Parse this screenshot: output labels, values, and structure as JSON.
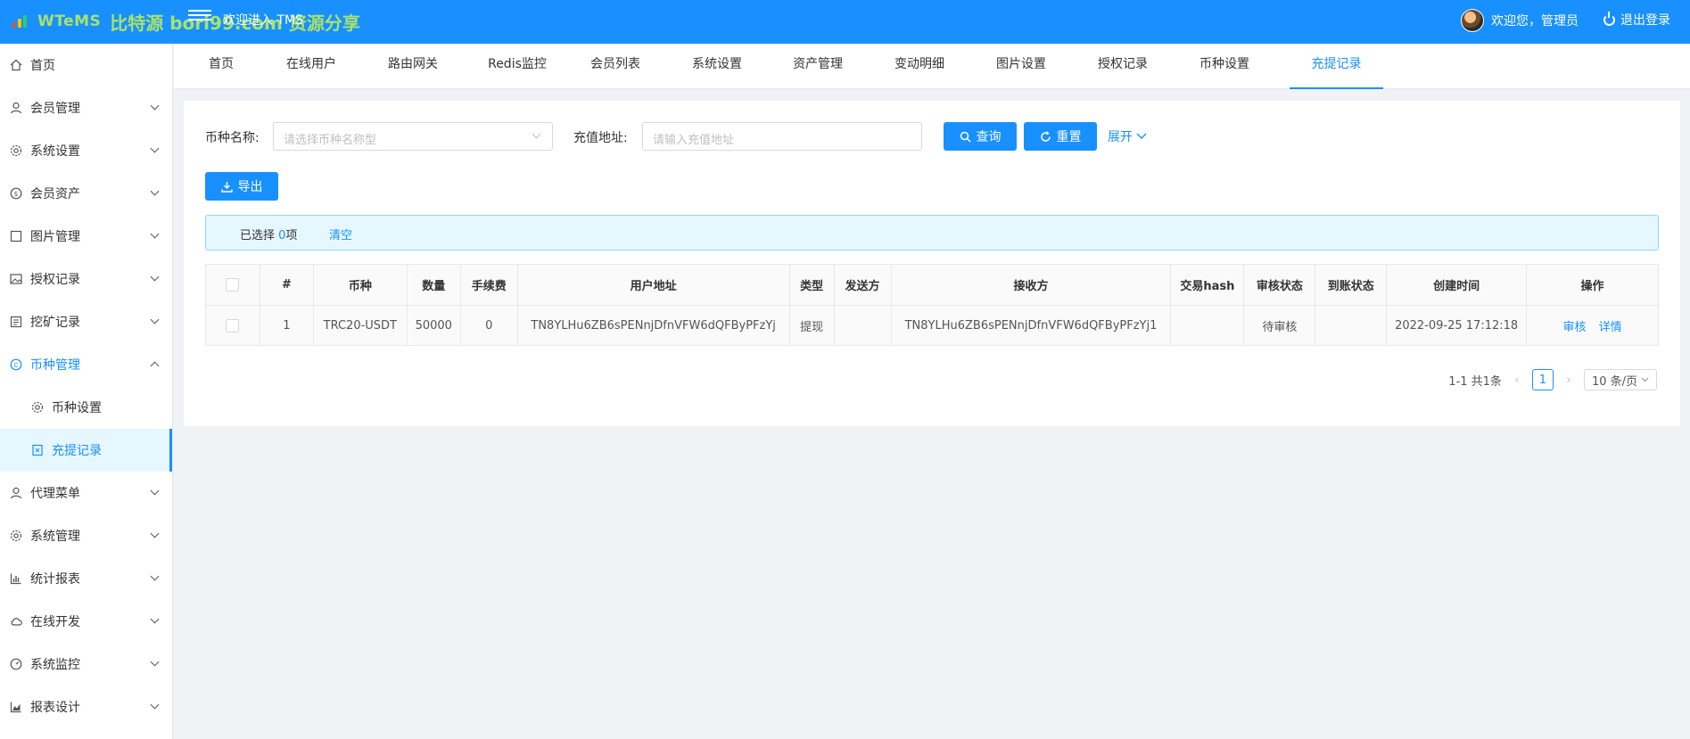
{
  "header": {
    "logo_text": "WTeMS",
    "watermark": "比特源 bori99.com 资源分享",
    "welcome": "欢迎进入 TMS",
    "user_greeting": "欢迎您，管理员",
    "logout": "退出登录"
  },
  "sidebar": {
    "items": [
      {
        "label": "首页",
        "icon": "home-icon"
      },
      {
        "label": "会员管理",
        "icon": "user-icon"
      },
      {
        "label": "系统设置",
        "icon": "gear-icon"
      },
      {
        "label": "会员资产",
        "icon": "coin-icon"
      },
      {
        "label": "图片管理",
        "icon": "square-icon"
      },
      {
        "label": "授权记录",
        "icon": "image-icon"
      },
      {
        "label": "挖矿记录",
        "icon": "list-icon"
      },
      {
        "label": "币种管理",
        "icon": "currency-icon"
      },
      {
        "label": "币种设置",
        "icon": "gear-icon"
      },
      {
        "label": "充提记录",
        "icon": "record-icon"
      },
      {
        "label": "代理菜单",
        "icon": "user-icon"
      },
      {
        "label": "系统管理",
        "icon": "gear-icon"
      },
      {
        "label": "统计报表",
        "icon": "bar-chart-icon"
      },
      {
        "label": "在线开发",
        "icon": "cloud-icon"
      },
      {
        "label": "系统监控",
        "icon": "gauge-icon"
      },
      {
        "label": "报表设计",
        "icon": "area-chart-icon"
      }
    ]
  },
  "tabs": [
    "首页",
    "在线用户",
    "路由网关",
    "Redis监控",
    "会员列表",
    "系统设置",
    "资产管理",
    "变动明细",
    "图片设置",
    "授权记录",
    "币种设置",
    "充提记录"
  ],
  "filters": {
    "coin_label": "币种名称:",
    "coin_placeholder": "请选择币种名称型",
    "address_label": "充值地址:",
    "address_placeholder": "请输入充值地址",
    "query": "查询",
    "reset": "重置",
    "expand": "展开"
  },
  "toolbar": {
    "export": "导出"
  },
  "selection": {
    "prefix": "已选择 ",
    "count": "0",
    "suffix": "项",
    "clear": "清空"
  },
  "table": {
    "headers": [
      "#",
      "币种",
      "数量",
      "手续费",
      "用户地址",
      "类型",
      "发送方",
      "接收方",
      "交易hash",
      "审核状态",
      "到账状态",
      "创建时间",
      "操作"
    ],
    "rows": [
      {
        "index": "1",
        "coin": "TRC20-USDT",
        "amount": "50000",
        "fee": "0",
        "user_address": "TN8YLHu6ZB6sPENnjDfnVFW6dQFByPFzYj",
        "type": "提现",
        "sender": "",
        "receiver": "TN8YLHu6ZB6sPENnjDfnVFW6dQFByPFzYj1",
        "tx_hash": "",
        "audit_status": "待审核",
        "arrival_status": "",
        "created_at": "2022-09-25 17:12:18",
        "actions": [
          "审核",
          "详情"
        ]
      }
    ]
  },
  "pagination": {
    "summary": "1-1 共1条",
    "current": "1",
    "page_size": "10 条/页"
  },
  "colors": {
    "primary": "#1890ff",
    "logo_green": "#a8e26b"
  }
}
